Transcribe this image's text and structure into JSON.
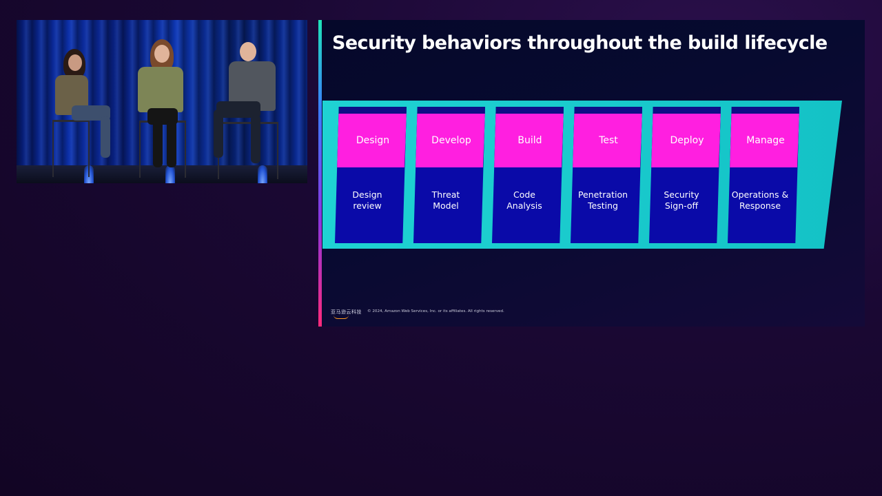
{
  "slide": {
    "title": "Security behaviors throughout the build lifecycle",
    "stages": [
      {
        "phase": "Design",
        "activity": "Design\nreview"
      },
      {
        "phase": "Develop",
        "activity": "Threat\nModel"
      },
      {
        "phase": "Build",
        "activity": "Code\nAnalysis"
      },
      {
        "phase": "Test",
        "activity": "Penetration\nTesting"
      },
      {
        "phase": "Deploy",
        "activity": "Security\nSign-off"
      },
      {
        "phase": "Manage",
        "activity": "Operations &\nResponse"
      }
    ],
    "footer": {
      "logo_text": "亚马逊云科技",
      "copyright": "© 2024, Amazon Web Services, Inc. or its affiliates. All rights reserved."
    }
  },
  "colors": {
    "phase_box": "#ff1fe0",
    "stage_body": "#0a0aa8",
    "band": "#1fd3d3",
    "background": "#1a0833"
  }
}
